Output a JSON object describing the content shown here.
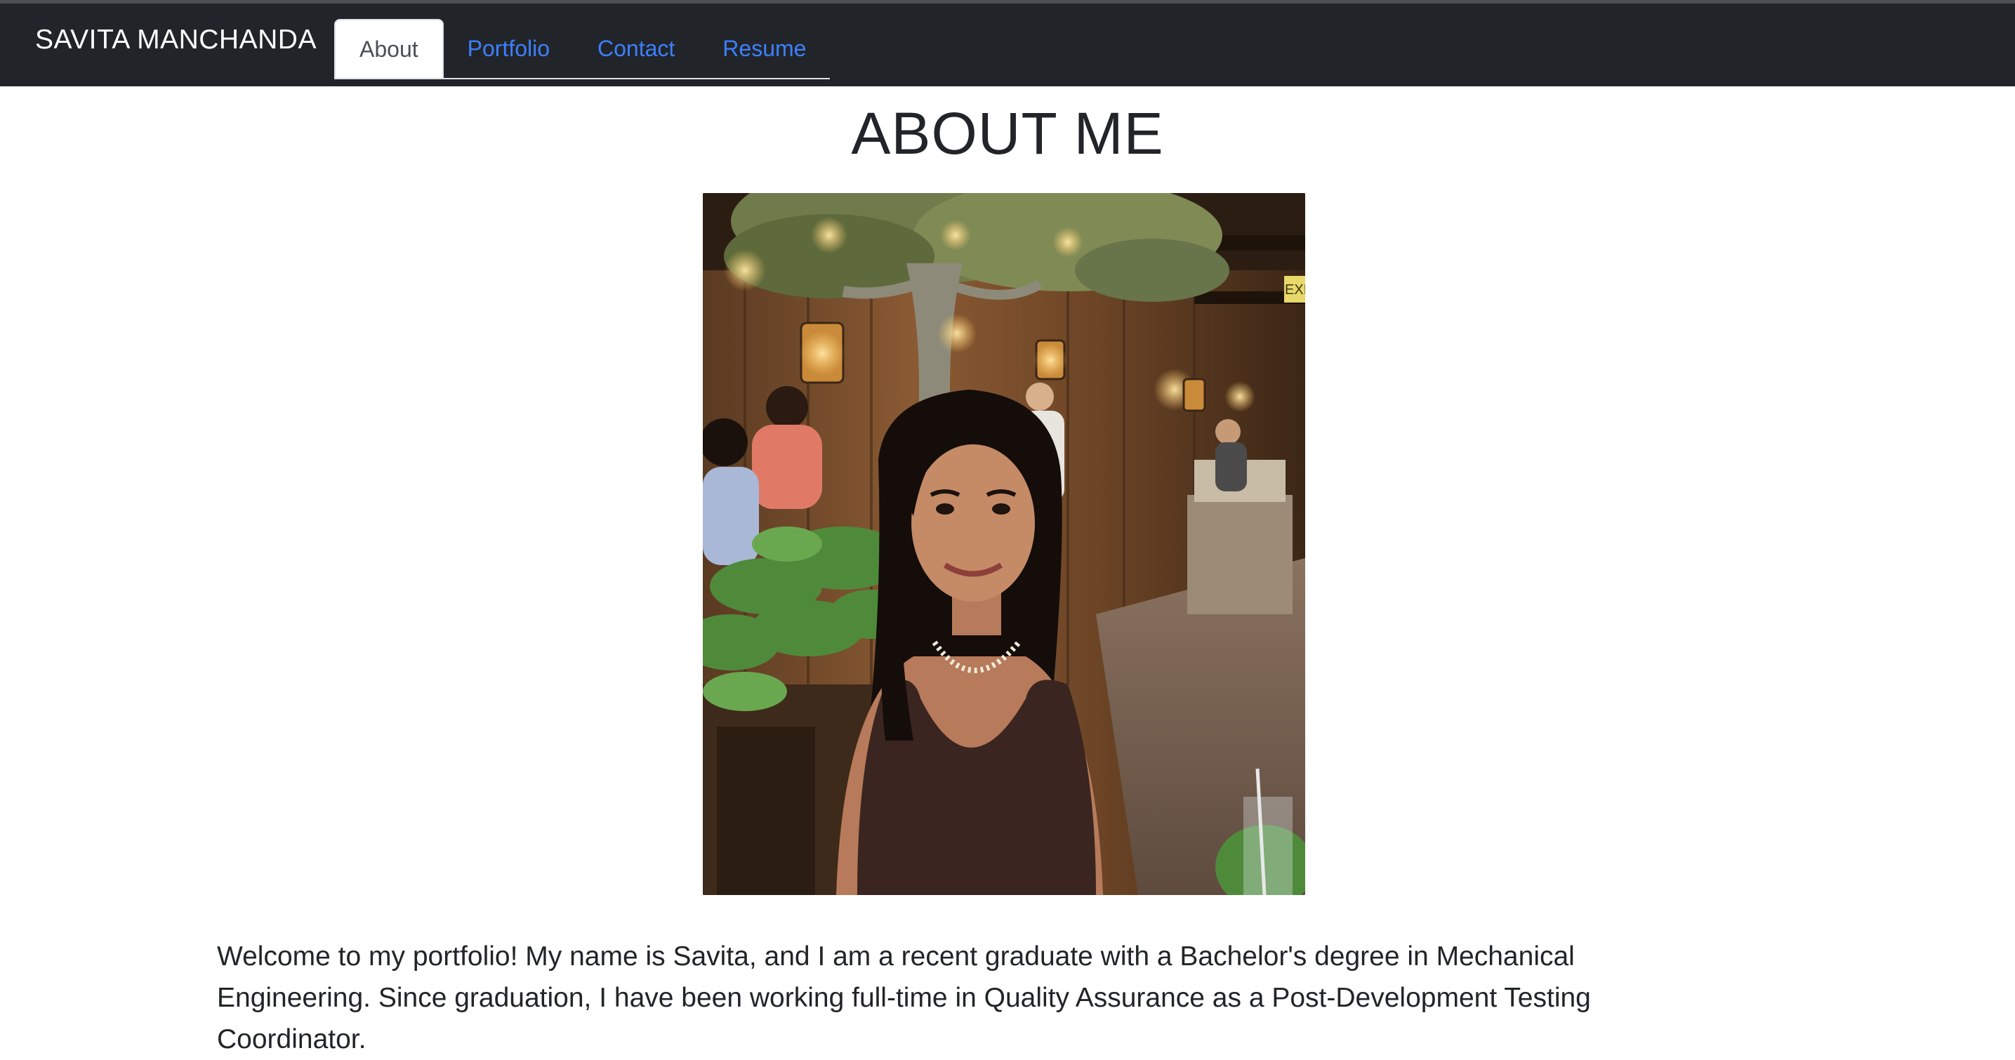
{
  "navbar": {
    "brand": "SAVITA MANCHANDA",
    "tabs": [
      {
        "label": "About",
        "active": true
      },
      {
        "label": "Portfolio",
        "active": false
      },
      {
        "label": "Contact",
        "active": false
      },
      {
        "label": "Resume",
        "active": false
      }
    ]
  },
  "main": {
    "title": "ABOUT ME",
    "photo_icon": "profile-photo",
    "photo_sign": "EXIT",
    "bio": "Welcome to my portfolio! My name is Savita, and I am a recent graduate with a Bachelor's degree in Mechanical Engineering. Since graduation, I have been working full-time in Quality Assurance as a Post-Development Testing Coordinator."
  },
  "colors": {
    "navbar_bg": "#212529",
    "link": "#3d7fff",
    "active_tab_text": "#495057",
    "text": "#212529"
  }
}
